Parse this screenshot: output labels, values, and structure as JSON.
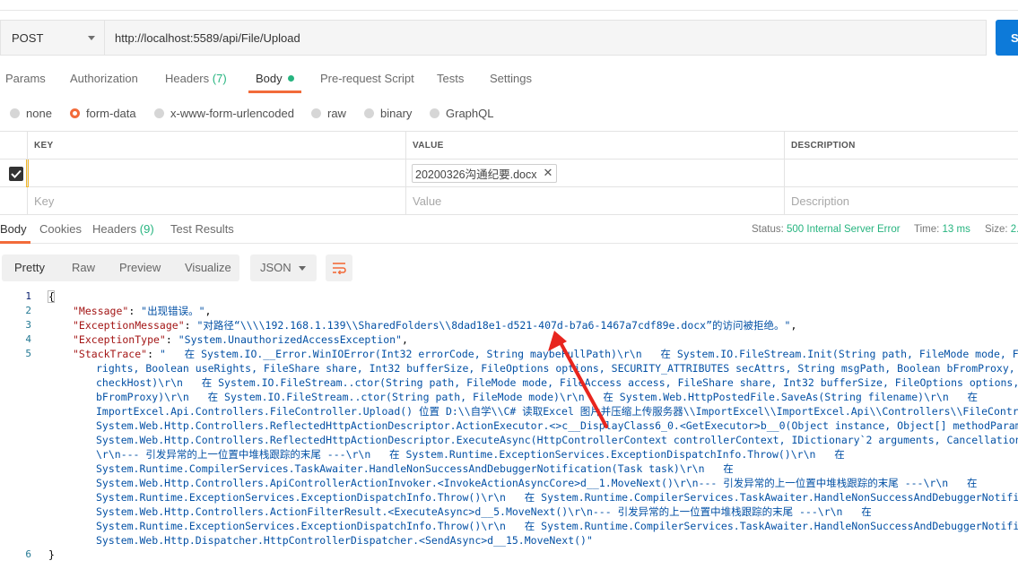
{
  "request": {
    "method": "POST",
    "url": "http://localhost:5589/api/File/Upload",
    "send_label": "S"
  },
  "request_tabs": [
    {
      "label": "Params"
    },
    {
      "label": "Authorization"
    },
    {
      "label": "Headers",
      "count": "(7)"
    },
    {
      "label": "Body"
    },
    {
      "label": "Pre-request Script"
    },
    {
      "label": "Tests"
    },
    {
      "label": "Settings"
    }
  ],
  "body_types": [
    "none",
    "form-data",
    "x-www-form-urlencoded",
    "raw",
    "binary",
    "GraphQL"
  ],
  "body_type_selected": "form-data",
  "kv_table": {
    "headers": {
      "key": "KEY",
      "value": "VALUE",
      "description": "DESCRIPTION"
    },
    "row1": {
      "key": "",
      "file": "20200326沟通纪要.docx",
      "description": "",
      "checked": true
    },
    "placeholders": {
      "key": "Key",
      "value": "Value",
      "description": "Description"
    }
  },
  "response_tabs": [
    {
      "label": "Body"
    },
    {
      "label": "Cookies"
    },
    {
      "label": "Headers",
      "count": "(9)"
    },
    {
      "label": "Test Results"
    }
  ],
  "response_status": {
    "status_label": "Status:",
    "status_value": "500 Internal Server Error",
    "time_label": "Time:",
    "time_value": "13 ms",
    "size_label": "Size:",
    "size_value": "2."
  },
  "response_toolbar": {
    "formats": [
      "Pretty",
      "Raw",
      "Preview",
      "Visualize"
    ],
    "active_format": "Pretty",
    "language": "JSON"
  },
  "code": {
    "line_numbers": [
      "1",
      "2",
      "3",
      "4",
      "5",
      "6"
    ],
    "open_brace": "{",
    "close_brace": "}",
    "message_key": "\"Message\"",
    "message_val": "\"出现错误。\"",
    "exmsg_key": "\"ExceptionMessage\"",
    "exmsg_val": "\"对路径“\\\\\\\\192.168.1.139\\\\SharedFolders\\\\8dad18e1-d521-407d-b7a6-1467a7cdf89e.docx”的访问被拒绝。\"",
    "extype_key": "\"ExceptionType\"",
    "extype_val": "\"System.UnauthorizedAccessException\"",
    "stack_key": "\"StackTrace\"",
    "stack_lines": [
      "\"   在 System.IO.__Error.WinIOError(Int32 errorCode, String maybeFullPath)\\r\\n   在 System.IO.FileStream.Init(String path, FileMode mode, FileAcce",
      "rights, Boolean useRights, FileShare share, Int32 bufferSize, FileOptions options, SECURITY_ATTRIBUTES secAttrs, String msgPath, Boolean bFromProxy, Boolea",
      "checkHost)\\r\\n   在 System.IO.FileStream..ctor(String path, FileMode mode, FileAccess access, FileShare share, Int32 bufferSize, FileOptions options, String",
      "bFromProxy)\\r\\n   在 System.IO.FileStream..ctor(String path, FileMode mode)\\r\\n   在 System.Web.HttpPostedFile.SaveAs(String filename)\\r\\n   在",
      "ImportExcel.Api.Controllers.FileController.Upload() 位置 D:\\\\自学\\\\C# 读取Excel 图片并压缩上传服务器\\\\ImportExcel\\\\ImportExcel.Api\\\\Controllers\\\\FileController",
      "System.Web.Http.Controllers.ReflectedHttpActionDescriptor.ActionExecutor.<>c__DisplayClass6_0.<GetExecutor>b__0(Object instance, Object[] methodParameters)\\",
      "System.Web.Http.Controllers.ReflectedHttpActionDescriptor.ExecuteAsync(HttpControllerContext controllerContext, IDictionary`2 arguments, CancellationToken c",
      "\\r\\n--- 引发异常的上一位置中堆栈跟踪的末尾 ---\\r\\n   在 System.Runtime.ExceptionServices.ExceptionDispatchInfo.Throw()\\r\\n   在",
      "System.Runtime.CompilerServices.TaskAwaiter.HandleNonSuccessAndDebuggerNotification(Task task)\\r\\n   在",
      "System.Web.Http.Controllers.ApiControllerActionInvoker.<InvokeActionAsyncCore>d__1.MoveNext()\\r\\n--- 引发异常的上一位置中堆栈跟踪的末尾 ---\\r\\n   在",
      "System.Runtime.ExceptionServices.ExceptionDispatchInfo.Throw()\\r\\n   在 System.Runtime.CompilerServices.TaskAwaiter.HandleNonSuccessAndDebuggerNotification(",
      "System.Web.Http.Controllers.ActionFilterResult.<ExecuteAsync>d__5.MoveNext()\\r\\n--- 引发异常的上一位置中堆栈跟踪的末尾 ---\\r\\n   在",
      "System.Runtime.ExceptionServices.ExceptionDispatchInfo.Throw()\\r\\n   在 System.Runtime.CompilerServices.TaskAwaiter.HandleNonSuccessAndDebuggerNotification(",
      "System.Web.Http.Dispatcher.HttpControllerDispatcher.<SendAsync>d__15.MoveNext()\""
    ]
  },
  "colors": {
    "accent_orange": "#f26b3a",
    "success_green": "#26b47f",
    "send_blue": "#0d7ad9",
    "annotation_red": "#e8251e"
  }
}
